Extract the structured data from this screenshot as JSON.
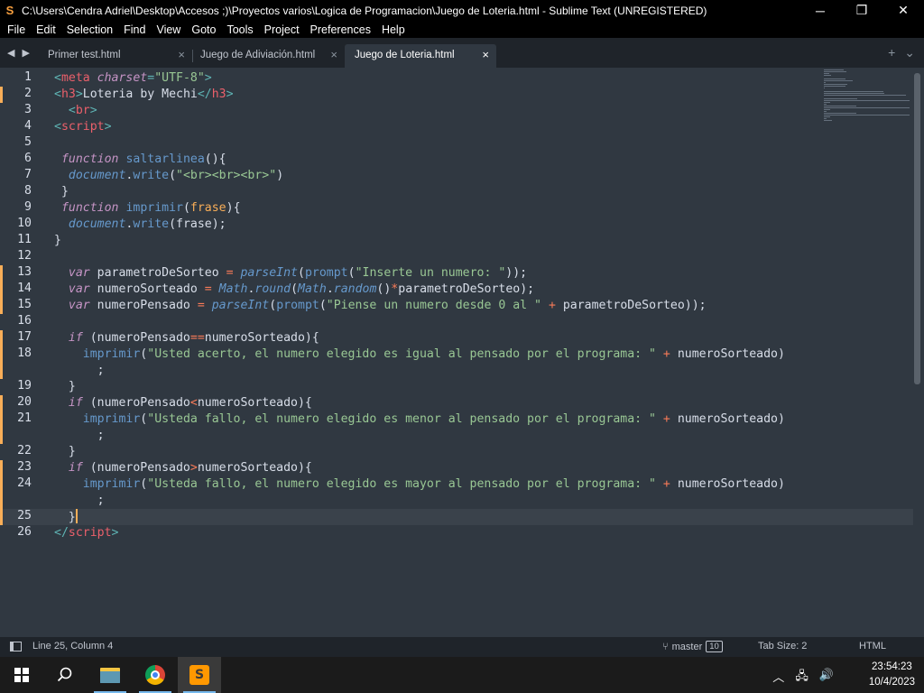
{
  "window": {
    "title": "C:\\Users\\Cendra Adriel\\Desktop\\Accesos ;)\\Proyectos varios\\Logica de Programacion\\Juego de Loteria.html - Sublime Text (UNREGISTERED)",
    "minimize": "─",
    "maximize": "❐",
    "close": "✕"
  },
  "menu": [
    "File",
    "Edit",
    "Selection",
    "Find",
    "View",
    "Goto",
    "Tools",
    "Project",
    "Preferences",
    "Help"
  ],
  "tabs": [
    {
      "label": "Primer test.html",
      "close": "×",
      "active": false
    },
    {
      "label": "Juego de Adiviación.html",
      "close": "×",
      "active": false
    },
    {
      "label": "Juego de Loteria.html",
      "close": "×",
      "active": true
    }
  ],
  "tab_actions": {
    "new": "+",
    "dropdown": "⌄"
  },
  "editor": {
    "line_numbers": [
      "1",
      "2",
      "3",
      "4",
      "5",
      "6",
      "7",
      "8",
      "9",
      "10",
      "11",
      "12",
      "13",
      "14",
      "15",
      "16",
      "17",
      "18",
      "",
      "19",
      "20",
      "21",
      "",
      "22",
      "23",
      "24",
      "",
      "25",
      "26"
    ],
    "current_line": "25",
    "lines": [
      {
        "row": 0,
        "tokens": [
          {
            "t": "<",
            "c": "pun"
          },
          {
            "t": "meta ",
            "c": "tag"
          },
          {
            "t": "charset",
            "c": "kw"
          },
          {
            "t": "=",
            "c": "pun"
          },
          {
            "t": "\"UTF-8\"",
            "c": "str"
          },
          {
            "t": ">",
            "c": "pun"
          }
        ]
      },
      {
        "row": 1,
        "tokens": [
          {
            "t": "<",
            "c": "pun"
          },
          {
            "t": "h3",
            "c": "tag"
          },
          {
            "t": ">",
            "c": "pun"
          },
          {
            "t": "Loteria by Mechi",
            "c": "var"
          },
          {
            "t": "</",
            "c": "pun"
          },
          {
            "t": "h3",
            "c": "tag"
          },
          {
            "t": ">",
            "c": "pun"
          }
        ]
      },
      {
        "row": 2,
        "tokens": [
          {
            "t": "  ",
            "c": "var"
          },
          {
            "t": "<",
            "c": "pun"
          },
          {
            "t": "br",
            "c": "tag"
          },
          {
            "t": ">",
            "c": "pun"
          }
        ]
      },
      {
        "row": 3,
        "tokens": [
          {
            "t": "<",
            "c": "pun"
          },
          {
            "t": "script",
            "c": "tag"
          },
          {
            "t": ">",
            "c": "pun"
          }
        ]
      },
      {
        "row": 4,
        "tokens": []
      },
      {
        "row": 5,
        "tokens": [
          {
            "t": " ",
            "c": "var"
          },
          {
            "t": "function",
            "c": "kw"
          },
          {
            "t": " ",
            "c": "var"
          },
          {
            "t": "saltarlinea",
            "c": "fn"
          },
          {
            "t": "(){",
            "c": "var"
          }
        ]
      },
      {
        "row": 6,
        "tokens": [
          {
            "t": "  ",
            "c": "var"
          },
          {
            "t": "document",
            "c": "obj"
          },
          {
            "t": ".",
            "c": "var"
          },
          {
            "t": "write",
            "c": "fn"
          },
          {
            "t": "(",
            "c": "var"
          },
          {
            "t": "\"<br><br><br>\"",
            "c": "str"
          },
          {
            "t": ")",
            "c": "var"
          }
        ]
      },
      {
        "row": 7,
        "tokens": [
          {
            "t": " }",
            "c": "var"
          }
        ]
      },
      {
        "row": 8,
        "tokens": [
          {
            "t": " ",
            "c": "var"
          },
          {
            "t": "function",
            "c": "kw"
          },
          {
            "t": " ",
            "c": "var"
          },
          {
            "t": "imprimir",
            "c": "fn"
          },
          {
            "t": "(",
            "c": "var"
          },
          {
            "t": "frase",
            "c": "par"
          },
          {
            "t": "){",
            "c": "var"
          }
        ]
      },
      {
        "row": 9,
        "tokens": [
          {
            "t": "  ",
            "c": "var"
          },
          {
            "t": "document",
            "c": "obj"
          },
          {
            "t": ".",
            "c": "var"
          },
          {
            "t": "write",
            "c": "fn"
          },
          {
            "t": "(frase);",
            "c": "var"
          }
        ]
      },
      {
        "row": 10,
        "tokens": [
          {
            "t": "}",
            "c": "var"
          }
        ]
      },
      {
        "row": 11,
        "tokens": []
      },
      {
        "row": 12,
        "tokens": [
          {
            "t": "  ",
            "c": "var"
          },
          {
            "t": "var",
            "c": "kw"
          },
          {
            "t": " parametroDeSorteo ",
            "c": "var"
          },
          {
            "t": "=",
            "c": "op"
          },
          {
            "t": " ",
            "c": "var"
          },
          {
            "t": "parseInt",
            "c": "bi"
          },
          {
            "t": "(",
            "c": "var"
          },
          {
            "t": "prompt",
            "c": "fn"
          },
          {
            "t": "(",
            "c": "var"
          },
          {
            "t": "\"Inserte un numero: \"",
            "c": "str"
          },
          {
            "t": "));",
            "c": "var"
          }
        ]
      },
      {
        "row": 13,
        "tokens": [
          {
            "t": "  ",
            "c": "var"
          },
          {
            "t": "var",
            "c": "kw"
          },
          {
            "t": " numeroSorteado ",
            "c": "var"
          },
          {
            "t": "=",
            "c": "op"
          },
          {
            "t": " ",
            "c": "var"
          },
          {
            "t": "Math",
            "c": "obj"
          },
          {
            "t": ".",
            "c": "var"
          },
          {
            "t": "round",
            "c": "bi"
          },
          {
            "t": "(",
            "c": "var"
          },
          {
            "t": "Math",
            "c": "obj"
          },
          {
            "t": ".",
            "c": "var"
          },
          {
            "t": "random",
            "c": "bi"
          },
          {
            "t": "()",
            "c": "var"
          },
          {
            "t": "*",
            "c": "op"
          },
          {
            "t": "parametroDeSorteo);",
            "c": "var"
          }
        ]
      },
      {
        "row": 14,
        "tokens": [
          {
            "t": "  ",
            "c": "var"
          },
          {
            "t": "var",
            "c": "kw"
          },
          {
            "t": " numeroPensado ",
            "c": "var"
          },
          {
            "t": "=",
            "c": "op"
          },
          {
            "t": " ",
            "c": "var"
          },
          {
            "t": "parseInt",
            "c": "bi"
          },
          {
            "t": "(",
            "c": "var"
          },
          {
            "t": "prompt",
            "c": "fn"
          },
          {
            "t": "(",
            "c": "var"
          },
          {
            "t": "\"Piense un numero desde 0 al \"",
            "c": "str"
          },
          {
            "t": " ",
            "c": "var"
          },
          {
            "t": "+",
            "c": "op"
          },
          {
            "t": " parametroDeSorteo));",
            "c": "var"
          }
        ]
      },
      {
        "row": 15,
        "tokens": []
      },
      {
        "row": 16,
        "tokens": [
          {
            "t": "  ",
            "c": "var"
          },
          {
            "t": "if",
            "c": "kw"
          },
          {
            "t": " (numeroPensado",
            "c": "var"
          },
          {
            "t": "==",
            "c": "op"
          },
          {
            "t": "numeroSorteado){",
            "c": "var"
          }
        ]
      },
      {
        "row": 17,
        "tokens": [
          {
            "t": "    ",
            "c": "var"
          },
          {
            "t": "imprimir",
            "c": "fn"
          },
          {
            "t": "(",
            "c": "var"
          },
          {
            "t": "\"Usted acerto, el numero elegido es igual al pensado por el programa: \"",
            "c": "str"
          },
          {
            "t": " ",
            "c": "var"
          },
          {
            "t": "+",
            "c": "op"
          },
          {
            "t": " numeroSorteado)",
            "c": "var"
          }
        ]
      },
      {
        "row": 18,
        "tokens": [
          {
            "t": "      ;",
            "c": "var"
          }
        ]
      },
      {
        "row": 19,
        "tokens": [
          {
            "t": "  }",
            "c": "var"
          }
        ]
      },
      {
        "row": 20,
        "tokens": [
          {
            "t": "  ",
            "c": "var"
          },
          {
            "t": "if",
            "c": "kw"
          },
          {
            "t": " (numeroPensado",
            "c": "var"
          },
          {
            "t": "<",
            "c": "op"
          },
          {
            "t": "numeroSorteado){",
            "c": "var"
          }
        ]
      },
      {
        "row": 21,
        "tokens": [
          {
            "t": "    ",
            "c": "var"
          },
          {
            "t": "imprimir",
            "c": "fn"
          },
          {
            "t": "(",
            "c": "var"
          },
          {
            "t": "\"Usteda fallo, el numero elegido es menor al pensado por el programa: \"",
            "c": "str"
          },
          {
            "t": " ",
            "c": "var"
          },
          {
            "t": "+",
            "c": "op"
          },
          {
            "t": " numeroSorteado)",
            "c": "var"
          }
        ]
      },
      {
        "row": 22,
        "tokens": [
          {
            "t": "      ;",
            "c": "var"
          }
        ]
      },
      {
        "row": 23,
        "tokens": [
          {
            "t": "  }",
            "c": "var"
          }
        ]
      },
      {
        "row": 24,
        "tokens": [
          {
            "t": "  ",
            "c": "var"
          },
          {
            "t": "if",
            "c": "kw"
          },
          {
            "t": " (numeroPensado",
            "c": "var"
          },
          {
            "t": ">",
            "c": "op"
          },
          {
            "t": "numeroSorteado){",
            "c": "var"
          }
        ]
      },
      {
        "row": 25,
        "tokens": [
          {
            "t": "    ",
            "c": "var"
          },
          {
            "t": "imprimir",
            "c": "fn"
          },
          {
            "t": "(",
            "c": "var"
          },
          {
            "t": "\"Usteda fallo, el numero elegido es mayor al pensado por el programa: \"",
            "c": "str"
          },
          {
            "t": " ",
            "c": "var"
          },
          {
            "t": "+",
            "c": "op"
          },
          {
            "t": " numeroSorteado)",
            "c": "var"
          }
        ]
      },
      {
        "row": 26,
        "tokens": [
          {
            "t": "      ;",
            "c": "var"
          }
        ]
      },
      {
        "row": 27,
        "tokens": [
          {
            "t": "  }",
            "c": "var"
          }
        ],
        "cursor": true
      },
      {
        "row": 28,
        "tokens": [
          {
            "t": "</",
            "c": "pun"
          },
          {
            "t": "script",
            "c": "tag"
          },
          {
            "t": ">",
            "c": "pun"
          }
        ]
      }
    ]
  },
  "status": {
    "position": "Line 25, Column 4",
    "branch": "master",
    "changes": "10",
    "tab_size": "Tab Size: 2",
    "syntax": "HTML"
  },
  "taskbar": {
    "time": "23:54:23",
    "date": "10/4/2023",
    "apps": [
      "file-explorer",
      "chrome",
      "sublime-text"
    ]
  },
  "colors": {
    "background": "#303841",
    "tag": "#eb606b",
    "string": "#99c794",
    "keyword": "#c594c5",
    "function": "#6699cc",
    "parameter": "#f9ae58",
    "operator": "#f97b58",
    "text": "#d8dee9"
  }
}
